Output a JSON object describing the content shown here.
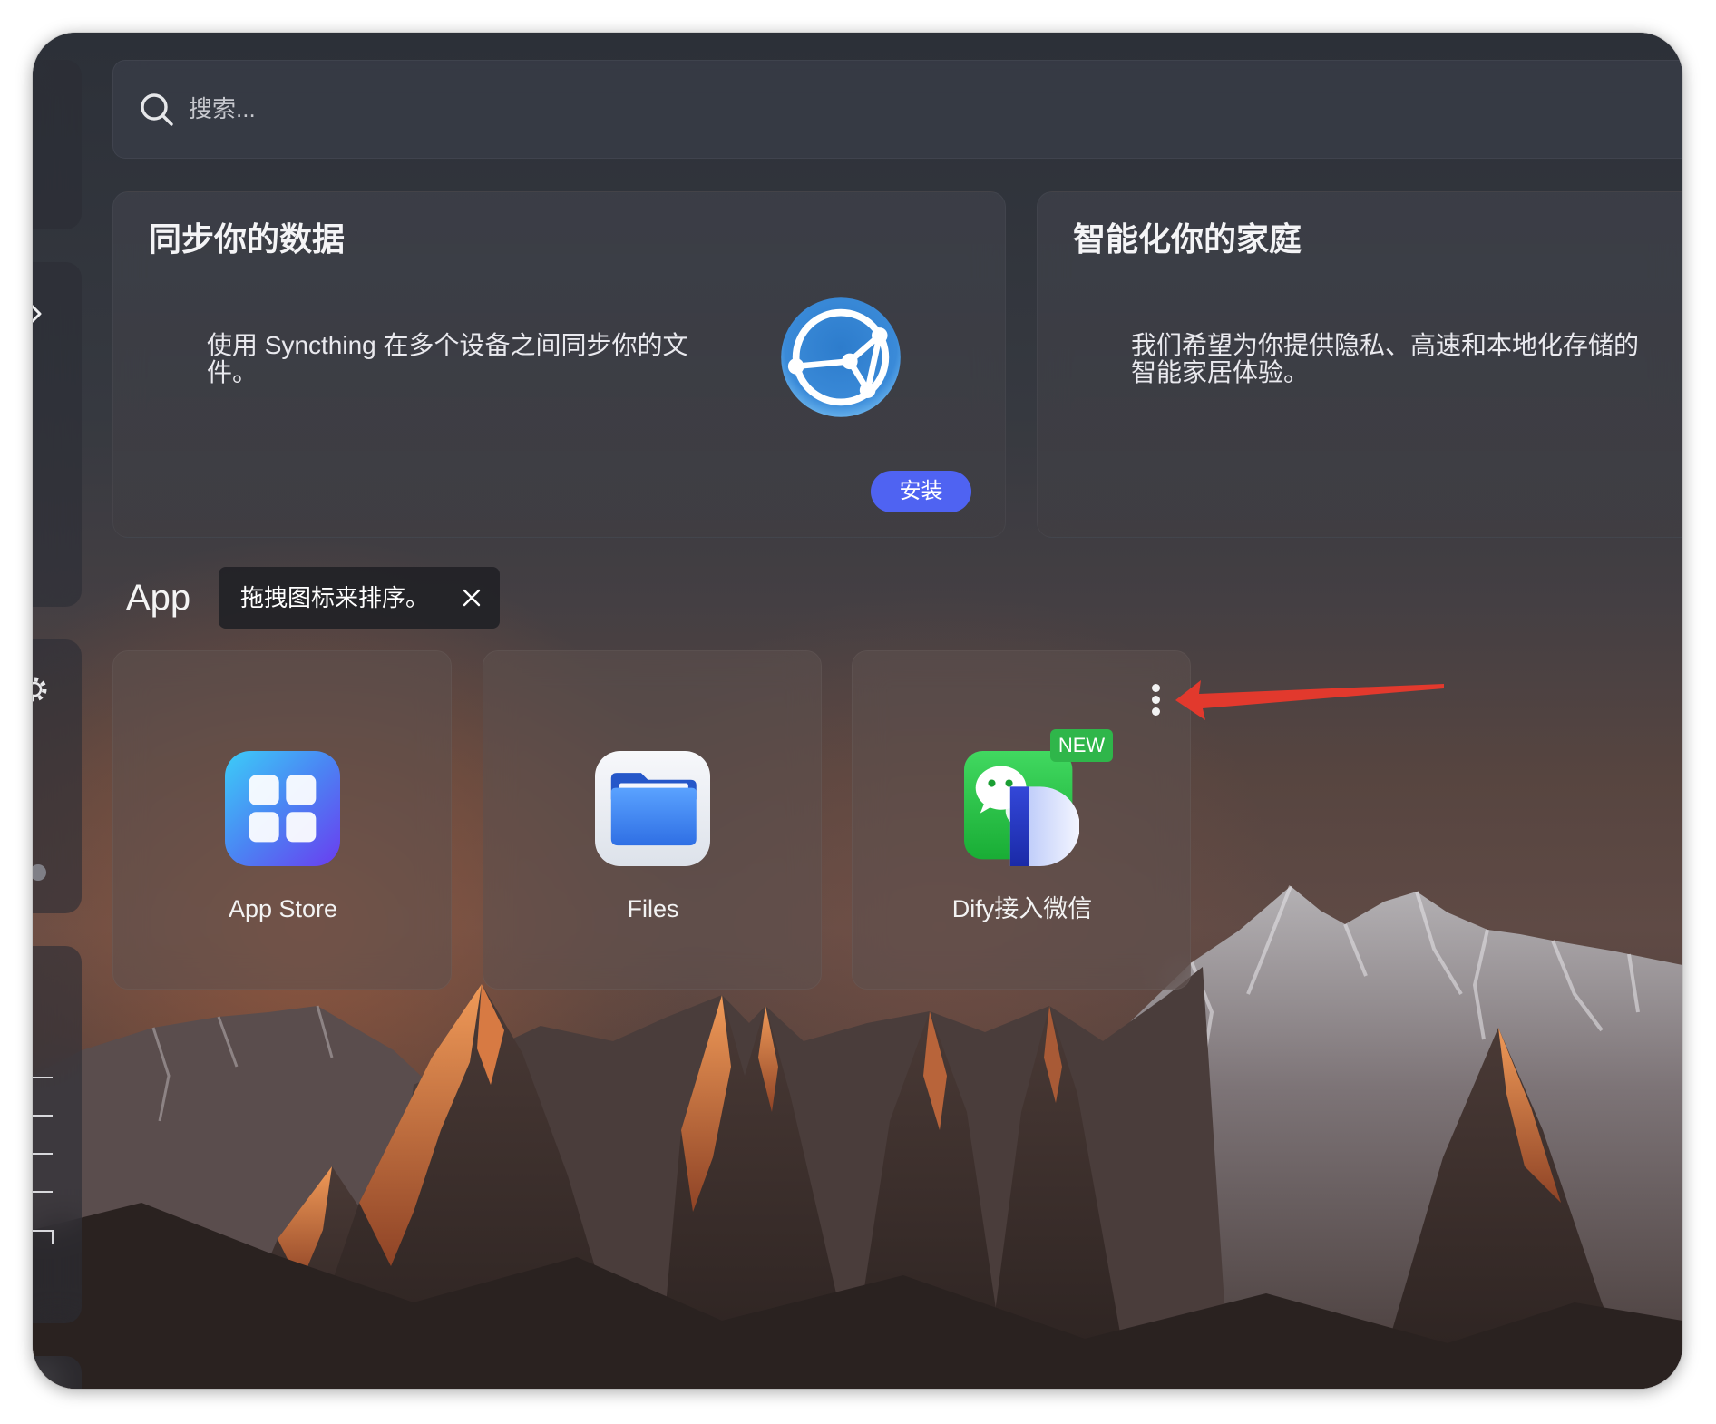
{
  "search": {
    "placeholder": "搜索..."
  },
  "featured": [
    {
      "title": "同步你的数据",
      "description": "使用 Syncthing 在多个设备之间同步你的文件。",
      "icon": "syncthing-icon",
      "button_label": "安装"
    },
    {
      "title": "智能化你的家庭",
      "description": "我们希望为你提供隐私、高速和本地化存储的智能家居体验。"
    }
  ],
  "apps": {
    "section_title": "App",
    "tip": "拖拽图标来排序。",
    "items": [
      {
        "name": "App Store",
        "icon": "app-store-icon"
      },
      {
        "name": "Files",
        "icon": "folder-icon"
      },
      {
        "name": "Dify接入微信",
        "icon": "dify-wechat-icon",
        "badge": "NEW"
      }
    ]
  },
  "sidebar": {
    "icons": [
      "chevron-right-icon",
      "gear-icon",
      "status-dot-icon",
      "list-icon"
    ]
  },
  "icons": {
    "search": "search-icon",
    "tip_close": "close-icon",
    "app_menu": "more-vertical-icon"
  },
  "colors": {
    "accent": "#4f63f2",
    "new_badge": "#2fb64a",
    "annotation_arrow": "#e2392d"
  }
}
